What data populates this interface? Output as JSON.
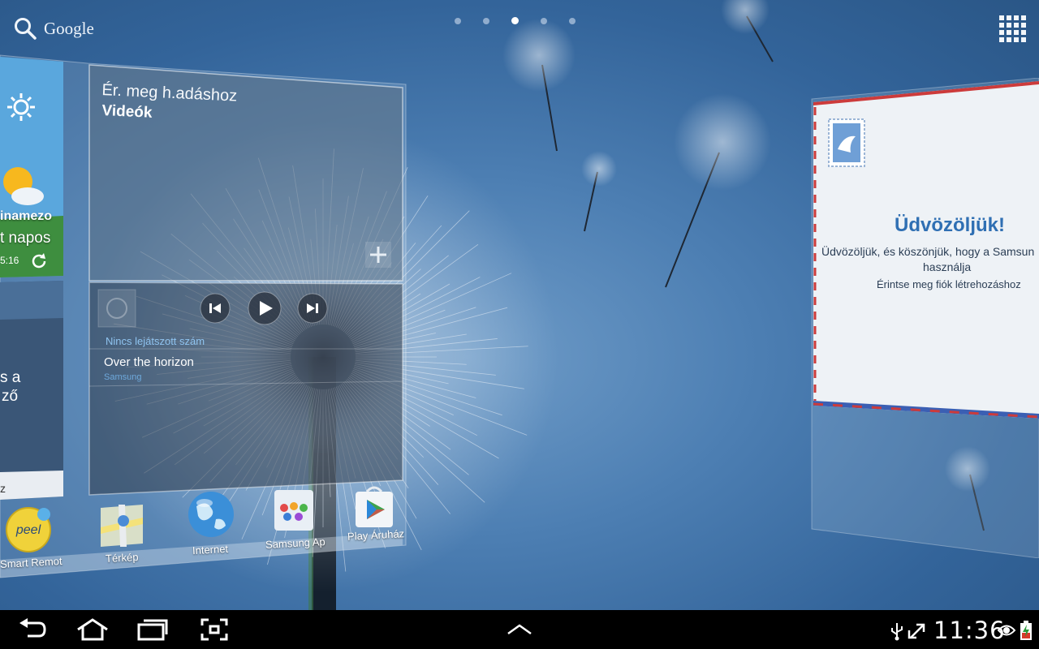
{
  "search": {
    "label": "Google",
    "icon": "search-icon"
  },
  "pager": {
    "count": 5,
    "active_index": 2
  },
  "apps_button": {
    "icon": "apps-grid-icon"
  },
  "video_widget": {
    "title": "Ér. meg h.adáshoz",
    "subtitle": "Videók",
    "add_icon": "plus-icon"
  },
  "music_widget": {
    "status": "Nincs lejátszott szám",
    "track_title": "Over the horizon",
    "track_artist": "Samsung",
    "controls": [
      "previous-icon",
      "play-icon",
      "next-icon"
    ]
  },
  "weather_widget_fragment": {
    "location": "inamezo",
    "condition": "t napos",
    "time": "5:16"
  },
  "left_text_fragments": {
    "line1": "s a",
    "line2": "ző",
    "line3": "z"
  },
  "dock": {
    "items": [
      {
        "label": "Smart Remot",
        "icon": "peel-icon"
      },
      {
        "label": "Térkép",
        "icon": "maps-icon"
      },
      {
        "label": "Internet",
        "icon": "globe-icon"
      },
      {
        "label": "Samsung Ap",
        "icon": "samsung-apps-icon"
      },
      {
        "label": "Play Áruház",
        "icon": "play-store-icon"
      }
    ]
  },
  "welcome_widget": {
    "title": "Üdvözöljük!",
    "line1": "Üdvözöljük, és köszönjük, hogy a Samsun",
    "line2": "használja",
    "line3": "Érintse meg fiók létrehozáshoz",
    "stamp_icon": "stamp-icon"
  },
  "navbar": {
    "buttons": [
      "back-icon",
      "home-icon",
      "recent-apps-icon",
      "screenshot-icon"
    ],
    "center": "chevron-up-icon",
    "status_icons": [
      "usb-icon",
      "sync-icon",
      "eye-icon",
      "battery-icon"
    ],
    "clock": "11:36"
  },
  "colors": {
    "accent_blue": "#2f6fb3",
    "link_blue": "#8fc3ef",
    "navbar": "#000000"
  }
}
